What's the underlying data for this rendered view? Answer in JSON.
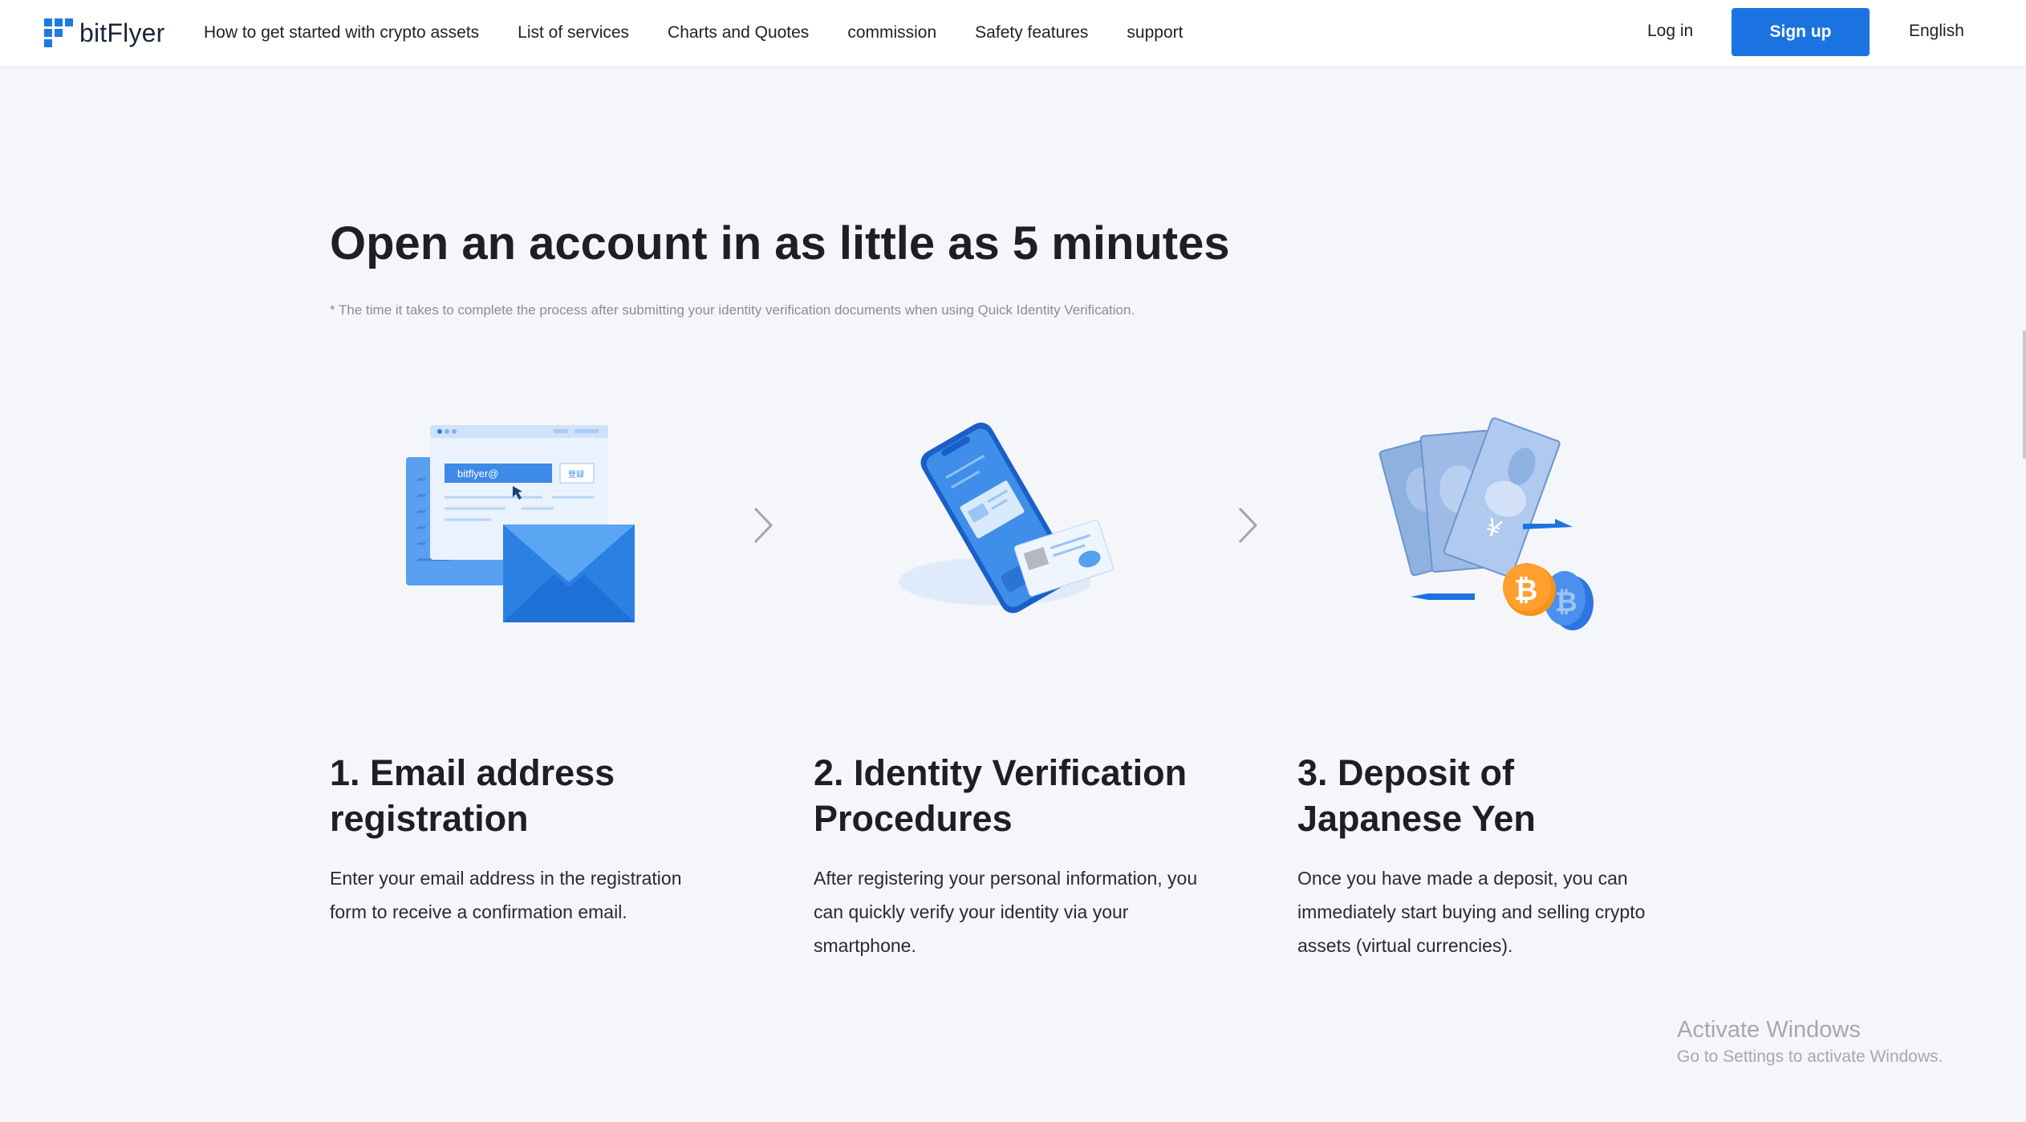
{
  "header": {
    "logo_text": "bitFlyer",
    "nav": [
      "How to get started with crypto assets",
      "List of services",
      "Charts and Quotes",
      "commission",
      "Safety features",
      "support"
    ],
    "login_label": "Log in",
    "signup_label": "Sign up",
    "language_label": "English"
  },
  "colors": {
    "brand_blue": "#1a73e0",
    "background": "#f5f6f9",
    "bitcoin_orange": "#f7931a"
  },
  "section": {
    "title": "Open an account in as little as 5 minutes",
    "note": "* The time it takes to complete the process after submitting your identity verification documents when using Quick Identity Verification."
  },
  "steps": [
    {
      "illustration": "email-envelope-browser-icon",
      "illustration_text": "bitflyer@",
      "illustration_button": "登録",
      "title": "1. Email address registration",
      "description": "Enter your email address in the registration form to receive a confirmation email."
    },
    {
      "illustration": "smartphone-id-card-icon",
      "title": "2. Identity Verification Procedures",
      "description": "After registering your personal information, you can quickly verify your identity via your smartphone."
    },
    {
      "illustration": "yen-bills-bitcoin-icon",
      "title": "3. Deposit of Japanese Yen",
      "description": "Once you have made a deposit, you can immediately start buying and selling crypto assets (virtual currencies)."
    }
  ],
  "watermark": {
    "line1": "Activate Windows",
    "line2": "Go to Settings to activate Windows."
  }
}
